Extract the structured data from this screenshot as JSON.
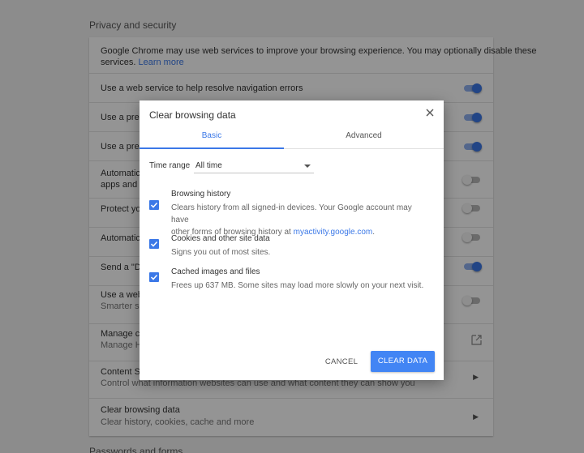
{
  "settings": {
    "section_title": "Privacy and security",
    "intro_text": "Google Chrome may use web services to improve your browsing experience. You may optionally disable these",
    "intro_text_2": "services.",
    "learn_more": "Learn more",
    "rows": [
      {
        "text": "Use a web service to help resolve navigation errors",
        "toggle": "on"
      },
      {
        "text": "Use a predi",
        "toggle": "on"
      },
      {
        "text": "Use a predi",
        "toggle": "on"
      },
      {
        "text": "Automatica",
        "sub": "apps and s",
        "toggle": "off"
      },
      {
        "text": "Protect you",
        "toggle": "off"
      },
      {
        "text": "Automatica",
        "toggle": "off"
      },
      {
        "text": "Send a \"Do",
        "toggle": "on"
      },
      {
        "text": "Use a web",
        "sub": "Smarter sp",
        "toggle": "off"
      },
      {
        "text": "Manage ce",
        "sub": "Manage HT"
      },
      {
        "text": "Content Se",
        "sub": "Control what information websites can use and what content they can show you"
      },
      {
        "text": "Clear browsing data",
        "sub": "Clear history, cookies, cache and more"
      }
    ],
    "next_section": "Passwords and forms"
  },
  "dialog": {
    "title": "Clear browsing data",
    "tabs": [
      "Basic",
      "Advanced"
    ],
    "time_range_label": "Time range",
    "time_range_value": "All time",
    "items": [
      {
        "title": "Browsing history",
        "desc_1": "Clears history from all signed-in devices. Your Google account may have",
        "desc_2": "other forms of browsing history at ",
        "link": "myactivity.google.com",
        "desc_3": ".",
        "checked": true
      },
      {
        "title": "Cookies and other site data",
        "desc": "Signs you out of most sites.",
        "checked": true
      },
      {
        "title": "Cached images and files",
        "desc": "Frees up 637 MB. Some sites may load more slowly on your next visit.",
        "checked": true
      }
    ],
    "cancel_label": "CANCEL",
    "clear_label": "CLEAR DATA"
  },
  "colors": {
    "accent": "#3b78e7",
    "button": "#4285f4"
  }
}
